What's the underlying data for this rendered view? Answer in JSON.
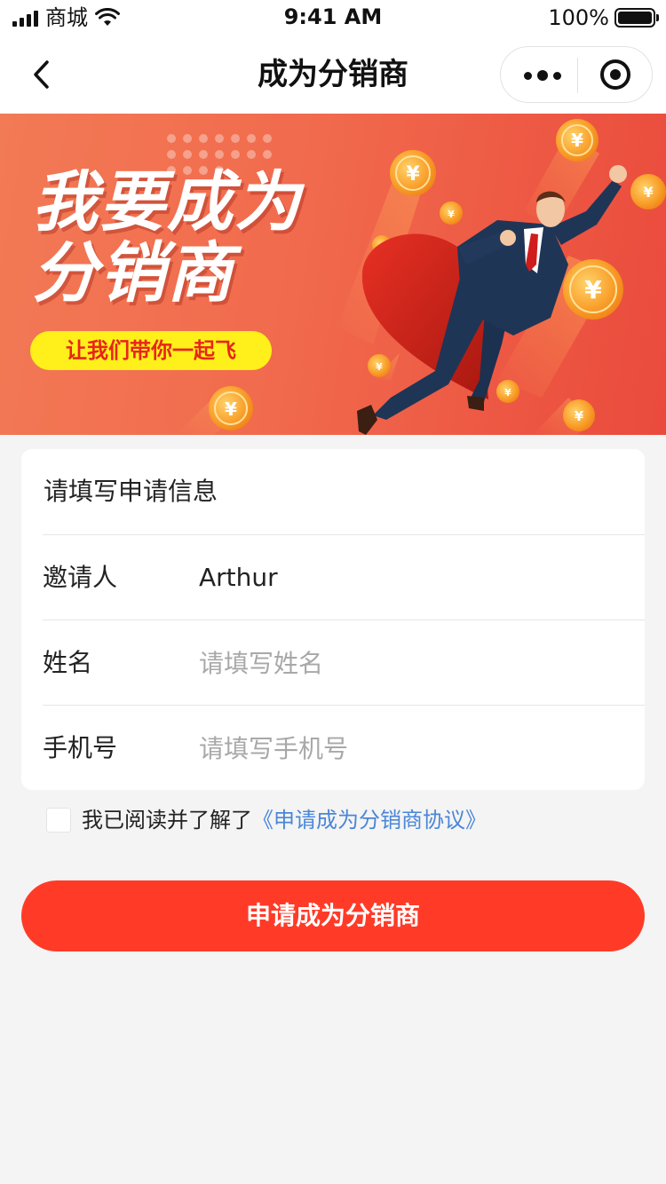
{
  "status_bar": {
    "carrier": "商城",
    "time": "9:41 AM",
    "battery": "100%"
  },
  "nav": {
    "title": "成为分销商",
    "back_icon": "chevron-left-icon",
    "more_icon": "more-dots-icon",
    "close_icon": "target-close-icon"
  },
  "banner": {
    "title_line1": "我要成为",
    "title_line2": "分销商",
    "slogan": "让我们带你一起飞",
    "coin_symbol": "¥",
    "colors": {
      "background_start": "#f27a55",
      "background_end": "#ea4a3c",
      "slogan_pill": "#ffef1a",
      "slogan_text": "#e8261a"
    }
  },
  "form": {
    "header": "请填写申请信息",
    "fields": [
      {
        "label": "邀请人",
        "value": "Arthur"
      },
      {
        "label": "姓名",
        "value": "",
        "placeholder": "请填写姓名"
      },
      {
        "label": "手机号",
        "value": "",
        "placeholder": "请填写手机号"
      }
    ]
  },
  "agreement": {
    "checked": false,
    "text": "我已阅读并了解了",
    "link": "《申请成为分销商协议》"
  },
  "submit": {
    "label": "申请成为分销商"
  },
  "theme": {
    "primary": "#ff3b28",
    "link": "#4a86d8",
    "background": "#f4f4f4"
  }
}
